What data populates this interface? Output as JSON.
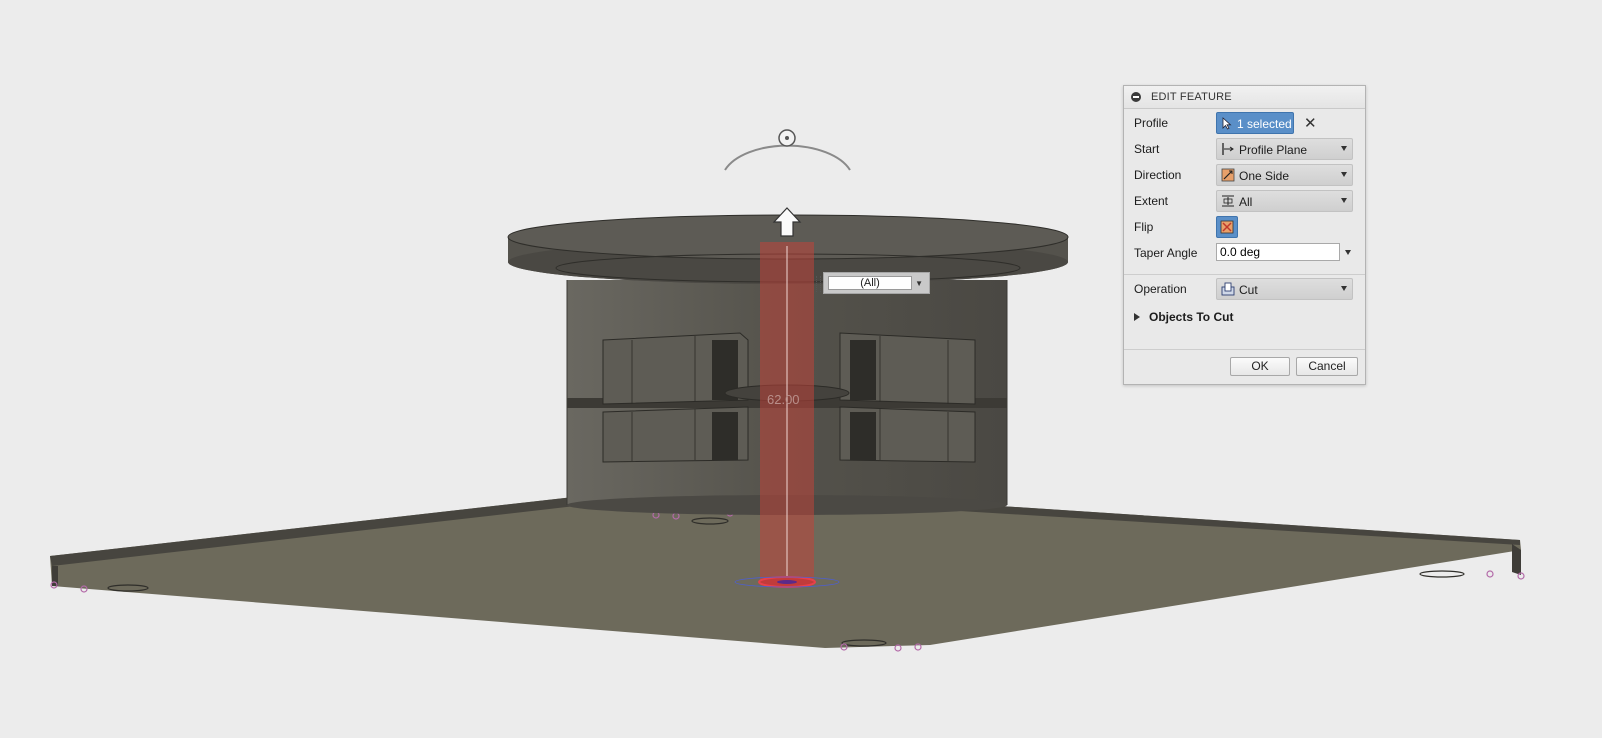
{
  "viewport": {
    "extent_popup_value": "(All)",
    "dimension_label": "62.00"
  },
  "dialog": {
    "title": "EDIT FEATURE",
    "rows": {
      "profile": {
        "label": "Profile",
        "value": "1 selected",
        "icon": "cursor-arrow-icon"
      },
      "start": {
        "label": "Start",
        "value": "Profile Plane",
        "icon": "profile-plane-icon"
      },
      "direction": {
        "label": "Direction",
        "value": "One Side",
        "icon": "one-side-icon"
      },
      "extent": {
        "label": "Extent",
        "value": "All",
        "icon": "extent-all-icon"
      },
      "flip": {
        "label": "Flip",
        "icon": "flip-icon"
      },
      "taper": {
        "label": "Taper Angle",
        "value": "0.0 deg"
      },
      "operation": {
        "label": "Operation",
        "value": "Cut",
        "icon": "cut-icon"
      }
    },
    "objects_to_cut": "Objects To Cut",
    "ok_label": "OK",
    "cancel_label": "Cancel"
  },
  "colors": {
    "background": "#ececec",
    "model_body": "#59574f",
    "base_plate": "#6e6b5c",
    "extrude_preview": "#c0443b",
    "selection_blue": "#5a8fc8"
  }
}
